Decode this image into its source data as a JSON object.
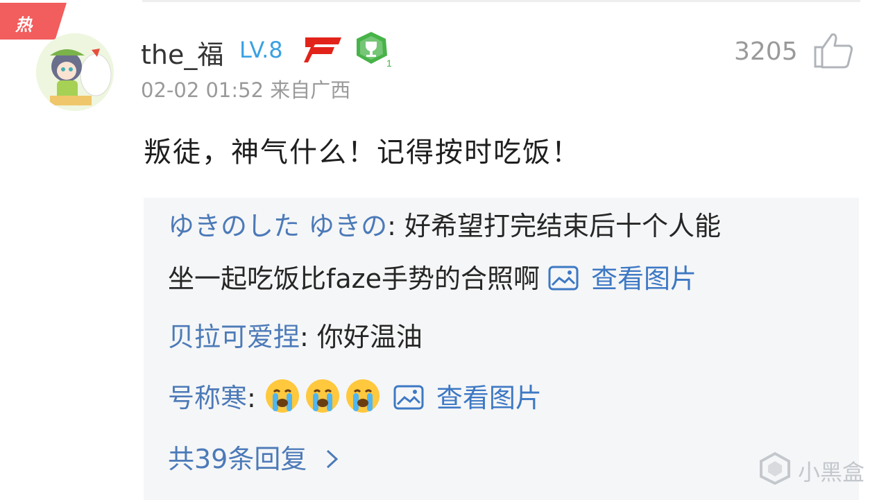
{
  "post": {
    "hot_label": "热",
    "username": "the_福",
    "level": "LV.8",
    "timestamp": "02-02 01:52 来自广西",
    "like_count": "3205",
    "content": "叛徒，神气什么！记得按时吃饭！"
  },
  "replies": [
    {
      "author": "ゆきのした ゆきの",
      "separator": ":",
      "text_line1": " 好希望打完结束后十个人能",
      "text_line2": "坐一起吃饭比faze手势的合照啊",
      "link": "查看图片"
    },
    {
      "author": "贝拉可爱捏",
      "separator": ":",
      "text": " 你好温油"
    },
    {
      "author": "号称寒",
      "separator": ":",
      "link": "查看图片",
      "emojis": [
        "crying-emoji",
        "crying-emoji",
        "crying-emoji"
      ]
    }
  ],
  "more_replies": "共39条回复",
  "watermark": "小黑盒",
  "colors": {
    "hot_badge": "#f25d5d",
    "level": "#3aa1e2",
    "author": "#4c7ab8",
    "link": "#3d78c4",
    "reply_bg": "#f5f6f7",
    "team_logo": "#e2231a"
  }
}
